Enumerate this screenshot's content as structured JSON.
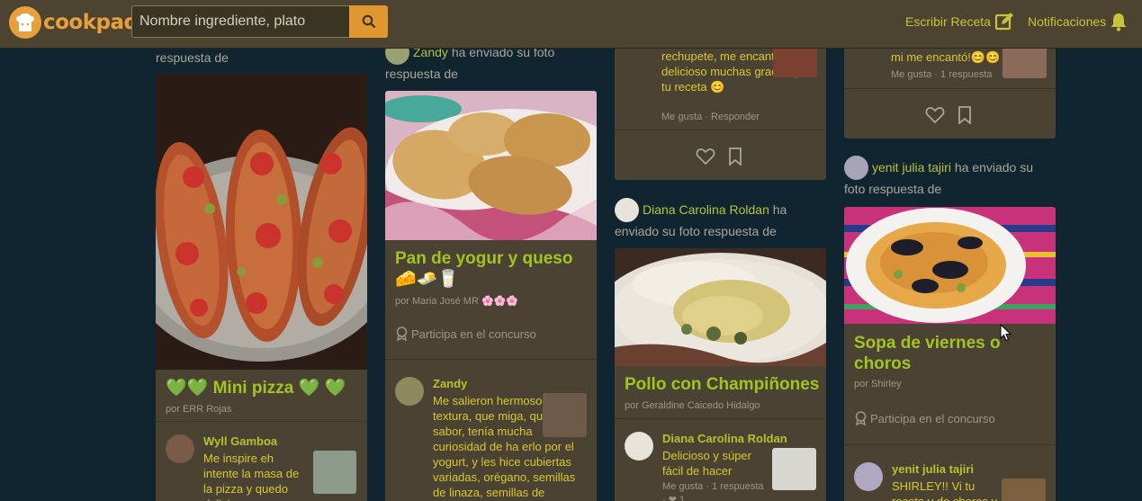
{
  "header": {
    "logo_text": "cookpad",
    "search_placeholder": "Nombre ingrediente, plato",
    "write_recipe": "Escribir Receta",
    "notifications": "Notificaciones"
  },
  "col1": {
    "activity_tail": "respuesta de",
    "title": "💚💚 Mini pizza 💚 💚",
    "byline": "por ERR Rojas",
    "comment": {
      "name": "Wyll Gamboa",
      "text": "Me inspire eh intente la masa de la pizza y quedo delicioso"
    }
  },
  "col2": {
    "activity_user": "Zandy",
    "activity_text": "ha enviado su foto",
    "activity_tail": "respuesta de",
    "title": "Pan de yogur y queso 🧀🧈🥛",
    "byline": "por Maria José MR 🌸🌸🌸",
    "contest": "Participa en el concurso",
    "comment": {
      "name": "Zandy",
      "text": "Me salieron hermosos, que textura, que miga, que sabor, tenía mucha curiosidad de ha erlo por el yogurt, y les hice cubiertas variadas, orégano, semillas de linaza, semillas de"
    }
  },
  "col3": {
    "comment_tail": "rechupete, me encanto delicioso muchas gracias por tu receta 😊",
    "like": "Me gusta",
    "reply": "Responder",
    "activity_user": "Diana Carolina Roldan",
    "activity_text": "ha",
    "activity_tail": "enviado su foto respuesta de",
    "title": "Pollo con Champiñones",
    "byline": "por Geraldine Caicedo Hidalgo",
    "comment": {
      "name": "Diana Carolina Roldan",
      "text": "Delicioso y súper fácil de hacer",
      "like": "Me gusta",
      "replies": "1 respuesta",
      "likes_count": "1"
    }
  },
  "col4": {
    "comment_tail": "mi me encantó!😊😊",
    "like": "Me gusta",
    "replies": "1 respuesta",
    "activity_user": "yenit julia tajiri",
    "activity_text": "ha enviado su",
    "activity_tail": "foto respuesta de",
    "title": "Sopa de viernes o choros",
    "byline": "por Shirley",
    "contest": "Participa en el concurso",
    "comment": {
      "name": "yenit julia tajiri",
      "text": "SHIRLEY!! Vi tu receta y de choros y"
    }
  },
  "colors": {
    "background": "#102530",
    "header": "#4c4430",
    "accent": "#e0972f",
    "title_green": "#a4c323",
    "card": "#4a4333"
  }
}
